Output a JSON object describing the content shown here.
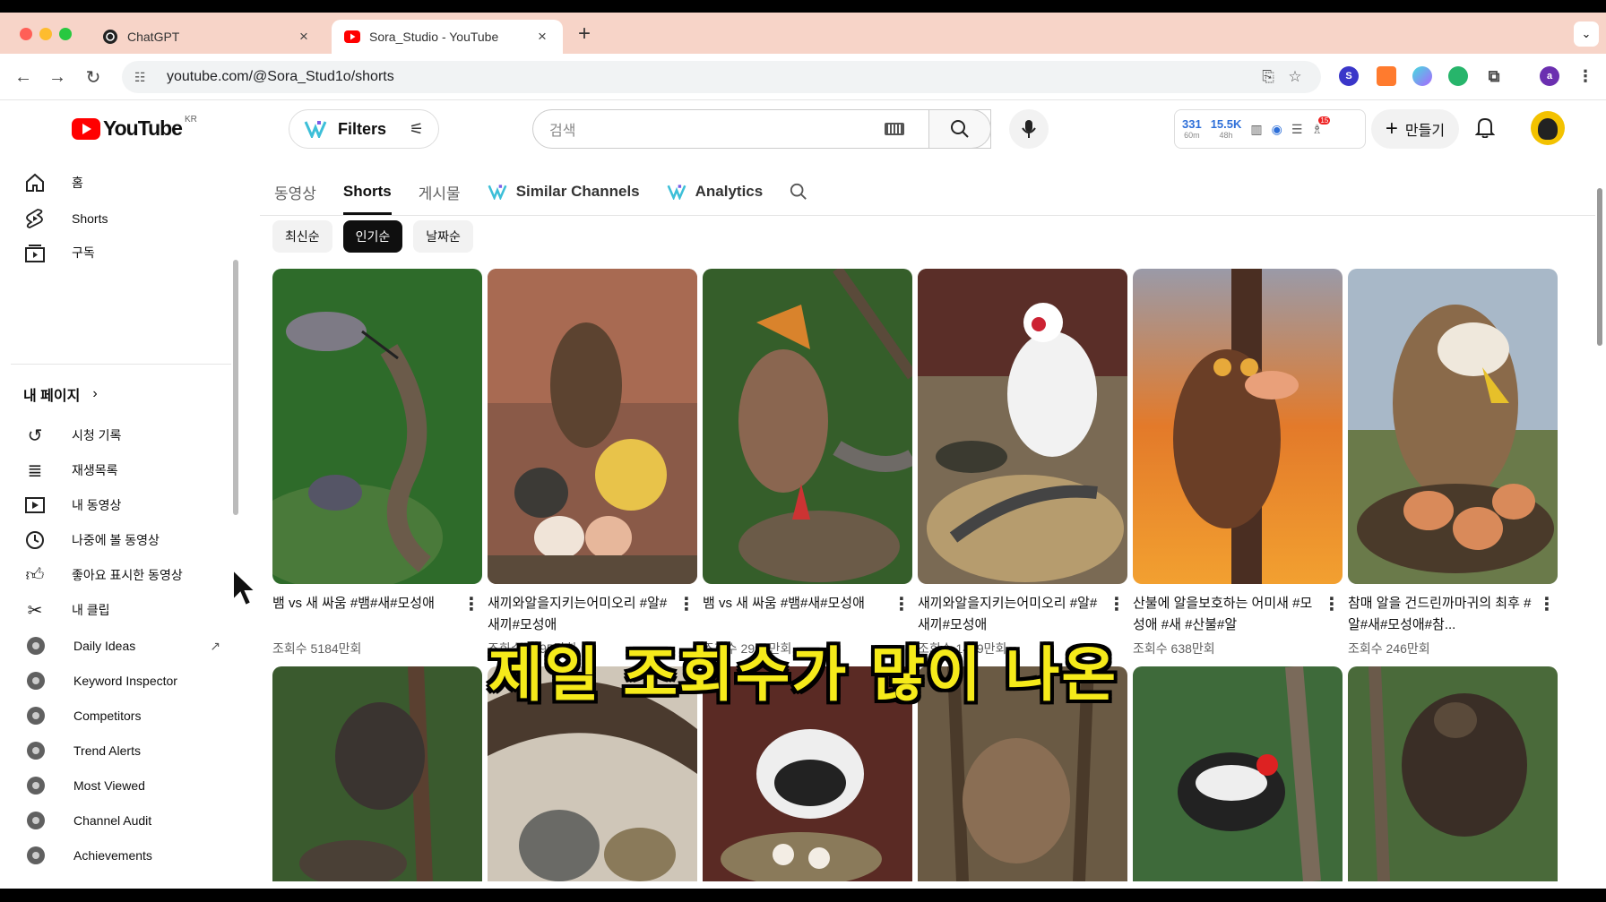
{
  "browser": {
    "tabs": [
      {
        "title": "ChatGPT",
        "active": false
      },
      {
        "title": "Sora_Studio - YouTube",
        "active": true
      }
    ],
    "new_tab": "+",
    "close_glyph": "×",
    "url": "youtube.com/@Sora_Stud1o/shorts",
    "extension_avatar": "a"
  },
  "header": {
    "logo_text": "YouTube",
    "region": "KR",
    "filters_label": "Filters",
    "search_placeholder": "검색",
    "stats": [
      {
        "value": "331",
        "sub": "60m"
      },
      {
        "value": "15.5K",
        "sub": "48h"
      }
    ],
    "notif_badge": "15",
    "create_label": "만들기"
  },
  "sidebar": {
    "primary": [
      {
        "label": "홈",
        "icon": "home-icon"
      },
      {
        "label": "Shorts",
        "icon": "shorts-icon"
      },
      {
        "label": "구독",
        "icon": "subscriptions-icon"
      }
    ],
    "my_page": "내 페이지",
    "library": [
      {
        "label": "시청 기록",
        "icon": "history-icon"
      },
      {
        "label": "재생목록",
        "icon": "playlist-icon"
      },
      {
        "label": "내 동영상",
        "icon": "my-videos-icon"
      },
      {
        "label": "나중에 볼 동영상",
        "icon": "watch-later-icon"
      },
      {
        "label": "좋아요 표시한 동영상",
        "icon": "like-icon"
      },
      {
        "label": "내 클립",
        "icon": "clip-icon"
      }
    ],
    "extensions": [
      {
        "label": "Daily Ideas",
        "external": true
      },
      {
        "label": "Keyword Inspector"
      },
      {
        "label": "Competitors"
      },
      {
        "label": "Trend Alerts"
      },
      {
        "label": "Most Viewed"
      },
      {
        "label": "Channel Audit"
      },
      {
        "label": "Achievements"
      }
    ]
  },
  "channel_tabs": [
    {
      "label": "동영상"
    },
    {
      "label": "Shorts",
      "active": true
    },
    {
      "label": "게시물"
    },
    {
      "label": "Similar Channels"
    },
    {
      "label": "Analytics"
    }
  ],
  "sort_chips": [
    {
      "label": "최신순"
    },
    {
      "label": "인기순",
      "selected": true
    },
    {
      "label": "날짜순"
    }
  ],
  "shorts": [
    {
      "title": "뱀 vs 새 싸움 #뱀#새#모성애",
      "views": "조회수 5184만회"
    },
    {
      "title": "새끼와알을지키는어미오리 #알#새끼#모성애",
      "views": "조회수 3695만회"
    },
    {
      "title": "뱀 vs 새 싸움 #뱀#새#모성애",
      "views": "조회수 2996만회"
    },
    {
      "title": "새끼와알을지키는어미오리 #알#새끼#모성애",
      "views": "조회수 1499만회"
    },
    {
      "title": "산불에 알을보호하는 어미새 #모성애 #새 #산불#알",
      "views": "조회수 638만회"
    },
    {
      "title": "참매 알을 건드린까마귀의 최후 #알#새#모성애#참...",
      "views": "조회수 246만회"
    }
  ],
  "overlay_subtitle": "제일 조회수가 많이 나온",
  "colors": {
    "youtube_red": "#ff0000",
    "subtitle_yellow": "#f5ea1a",
    "tabbar_peach": "#f7d4c8"
  }
}
